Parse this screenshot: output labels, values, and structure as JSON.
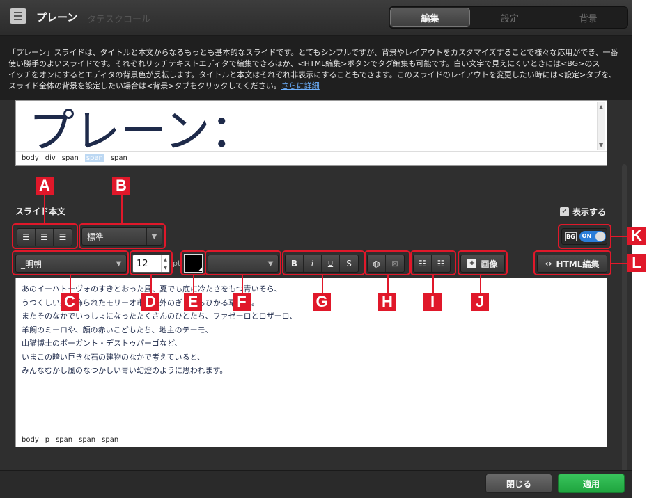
{
  "header": {
    "title": "プレーン",
    "ghost_title": "タテスクロール",
    "tabs": [
      {
        "label": "編集",
        "active": true
      },
      {
        "label": "設定",
        "active": false
      },
      {
        "label": "背景",
        "active": false
      }
    ]
  },
  "info": {
    "lines": [
      "「プレーン」スライドは、タイトルと本文からなるもっとも基本的なスライドです。とてもシンプルですが、背景やレイアウトをカスタマイズすることで様々な応用ができ、一番",
      "使い勝手のよいスライドです。それぞれリッチテキストエディタで編集できるほか、<HTML編集>ボタンでタグ編集も可能です。白い文字で見えにくいときには<BG>のス",
      "イッチをオンにするとエディタの背景色が反転します。タイトルと本文はそれぞれ非表示にすることもできます。このスライドのレイアウトを変更したい時には<設定>タブを、",
      "スライド全体の背景を設定したい場合は<背景>タブをクリックしてください。"
    ],
    "link": "さらに詳細"
  },
  "title_editor": {
    "content": "プレーン：",
    "path": [
      "body",
      "div",
      "span",
      "span",
      "span"
    ],
    "selected_index": 3
  },
  "body_section": {
    "label": "スライド本文",
    "show_label": "表示する",
    "show_checked": true
  },
  "toolbar": {
    "align_icons": [
      "align-left-icon",
      "align-center-icon",
      "align-right-icon"
    ],
    "style_select": "標準",
    "font_select": "_明朝",
    "font_size": "12",
    "pt_label": "pt",
    "text_color": "#000000",
    "bold": "B",
    "italic": "i",
    "underline": "U",
    "strike": "S",
    "bg_label": "BG",
    "toggle_state": "ON",
    "image_button": "画像",
    "html_button": "HTML編集"
  },
  "body_editor": {
    "lines": [
      "あのイーハトーヴォのすきとおった風、夏でも底に冷たさをもつ青いそら、",
      "うつくしい森で飾られたモリーオ市、郊外のぎらぎらひかる草の波。",
      "またそのなかでいっしょになったたくさんのひとたち、ファゼーロとロザーロ、",
      "羊飼のミーロや、顔の赤いこどもたち、地主のテーモ、",
      "山猫博士のボーガント・デストゥパーゴなど、",
      "いまこの暗い巨きな石の建物のなかで考えていると、",
      "みんなむかし風のなつかしい青い幻燈のように思われます。"
    ],
    "path": [
      "body",
      "p",
      "span",
      "span",
      "span"
    ]
  },
  "footer": {
    "close_label": "閉じる",
    "apply_label": "適用"
  },
  "callouts": [
    "A",
    "B",
    "C",
    "D",
    "E",
    "F",
    "G",
    "H",
    "I",
    "J",
    "K",
    "L"
  ],
  "colors": {
    "accent_red": "#e0182a",
    "apply_green": "#2db34f",
    "toggle_blue": "#2b7dd8",
    "link_blue": "#6db1ff"
  }
}
